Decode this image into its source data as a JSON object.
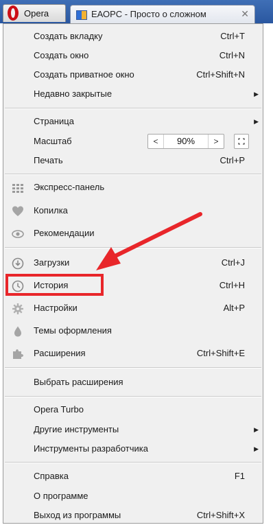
{
  "browser": {
    "opera_button_label": "Opera",
    "tab_title": "ЕАОРС - Просто о сложном",
    "tab_close": "✕"
  },
  "menu": {
    "items": [
      {
        "label": "Создать вкладку",
        "shortcut": "Ctrl+T"
      },
      {
        "label": "Создать окно",
        "shortcut": "Ctrl+N"
      },
      {
        "label": "Создать приватное окно",
        "shortcut": "Ctrl+Shift+N"
      },
      {
        "label": "Недавно закрытые",
        "submenu": "▶"
      },
      {
        "label": "Страница",
        "submenu": "▶"
      },
      {
        "label": "Масштаб"
      },
      {
        "label": "Печать",
        "shortcut": "Ctrl+P"
      },
      {
        "label": "Экспресс-панель"
      },
      {
        "label": "Копилка"
      },
      {
        "label": "Рекомендации"
      },
      {
        "label": "Загрузки",
        "shortcut": "Ctrl+J"
      },
      {
        "label": "История",
        "shortcut": "Ctrl+H"
      },
      {
        "label": "Настройки",
        "shortcut": "Alt+P"
      },
      {
        "label": "Темы оформления"
      },
      {
        "label": "Расширения",
        "shortcut": "Ctrl+Shift+E"
      },
      {
        "label": "Выбрать расширения"
      },
      {
        "label": "Opera Turbo"
      },
      {
        "label": "Другие инструменты",
        "submenu": "▶"
      },
      {
        "label": "Инструменты разработчика",
        "submenu": "▶"
      },
      {
        "label": "Справка",
        "shortcut": "F1"
      },
      {
        "label": "О программе"
      },
      {
        "label": "Выход из программы",
        "shortcut": "Ctrl+Shift+X"
      }
    ]
  },
  "zoom": {
    "decrease": "<",
    "value": "90%",
    "increase": ">"
  },
  "icons": {
    "speed_dial": "speed-dial-icon",
    "stash": "heart-icon",
    "discover": "eye-icon",
    "downloads": "download-icon",
    "history": "clock-icon",
    "settings": "gear-icon",
    "themes": "paint-drop-icon",
    "extensions": "puzzle-icon",
    "fullscreen": "fullscreen-icon"
  },
  "colors": {
    "accent": "#e8262a",
    "opera_red": "#cc0f16",
    "menu_background": "#f0f0f0",
    "tab_bar": "#2a57a0"
  }
}
